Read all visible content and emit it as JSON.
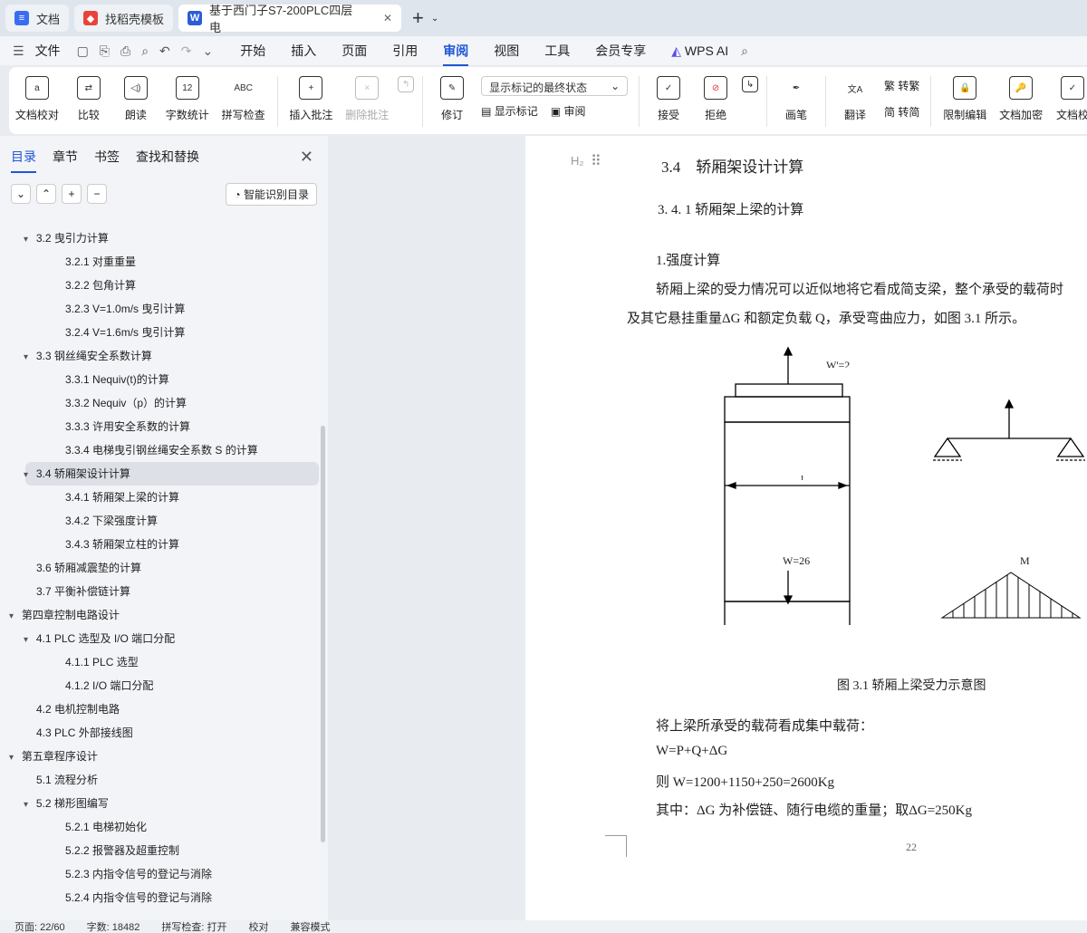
{
  "tabs": [
    {
      "label": "文档",
      "icon": "docs-icon",
      "color": "#3a6df0"
    },
    {
      "label": "找稻壳模板",
      "icon": "docer-icon",
      "color": "#e8443a"
    },
    {
      "label": "基于西门子S7-200PLC四层电",
      "icon": "word-icon",
      "color": "#2b5cd8"
    }
  ],
  "menu": {
    "file": "文件",
    "items": [
      "开始",
      "插入",
      "页面",
      "引用",
      "审阅",
      "视图",
      "工具",
      "会员专享"
    ],
    "active": "审阅",
    "wps_ai": "WPS AI"
  },
  "ribbon": {
    "b1": [
      "文档校对",
      "比较",
      "朗读",
      "字数统计",
      "拼写检查"
    ],
    "b2": [
      "插入批注",
      "删除批注"
    ],
    "markup_state": "显示标记的最终状态",
    "b3": [
      "修订",
      "显示标记",
      "审阅"
    ],
    "b4": [
      "接受",
      "拒绝"
    ],
    "b5": [
      "画笔"
    ],
    "b6": [
      "翻译",
      "繁转简",
      "转繁",
      "转简"
    ],
    "b7": [
      "限制编辑",
      "文档加密",
      "文档校"
    ]
  },
  "sidebar": {
    "tabs": [
      "目录",
      "章节",
      "书签",
      "查找和替换"
    ],
    "smart_toc": "智能识别目录",
    "items": [
      {
        "t": "3.2 曳引力计算",
        "l": 1,
        "e": true
      },
      {
        "t": "3.2.1  对重重量",
        "l": 2
      },
      {
        "t": "3.2.2   包角计算",
        "l": 2
      },
      {
        "t": "3.2.3  V=1.0m/s 曳引计算",
        "l": 2
      },
      {
        "t": "3.2.4   V=1.6m/s 曳引计算",
        "l": 2
      },
      {
        "t": "3.3   钢丝绳安全系数计算",
        "l": 1,
        "e": true
      },
      {
        "t": "3.3.1 Nequiv(t)的计算",
        "l": 2
      },
      {
        "t": "3.3.2 Nequiv（p）的计算",
        "l": 2
      },
      {
        "t": "3.3.3 许用安全系数的计算",
        "l": 2
      },
      {
        "t": "3.3.4 电梯曳引钢丝绳安全系数 S 的计算",
        "l": 2
      },
      {
        "t": "3.4   轿厢架设计计算",
        "l": 1,
        "e": true,
        "sel": true
      },
      {
        "t": "3.4.1 轿厢架上梁的计算",
        "l": 2
      },
      {
        "t": "3.4.2 下梁强度计算",
        "l": 2
      },
      {
        "t": "3.4.3 轿厢架立柱的计算",
        "l": 2
      },
      {
        "t": "3.6 轿厢减震垫的计算",
        "l": 1
      },
      {
        "t": "3.7 平衡补偿链计算",
        "l": 1
      },
      {
        "t": "第四章控制电路设计",
        "l": 0,
        "e": true
      },
      {
        "t": "4.1 PLC 选型及 I/O 端口分配",
        "l": 1,
        "e": true
      },
      {
        "t": "4.1.1 PLC 选型",
        "l": 2
      },
      {
        "t": "4.1.2 I/O 端口分配",
        "l": 2
      },
      {
        "t": "4.2  电机控制电路",
        "l": 1
      },
      {
        "t": "4.3 PLC 外部接线图",
        "l": 1
      },
      {
        "t": "第五章程序设计",
        "l": 0,
        "e": true
      },
      {
        "t": "5.1  流程分析",
        "l": 1
      },
      {
        "t": "5.2  梯形图编写",
        "l": 1,
        "e": true
      },
      {
        "t": "5.2.1  电梯初始化",
        "l": 2
      },
      {
        "t": "5.2.2 报警器及超重控制",
        "l": 2
      },
      {
        "t": "5.2.3  内指令信号的登记与消除",
        "l": 2
      },
      {
        "t": "5.2.4 内指令信号的登记与消除",
        "l": 2
      }
    ]
  },
  "doc": {
    "heading_mark": "H₂",
    "h3_num": "3.4",
    "h3_text": "轿厢架设计计算",
    "h4": "3. 4. 1 轿厢架上梁的计算",
    "p1": "1.强度计算",
    "p2": "轿厢上梁的受力情况可以近似地将它看成简支梁，整个承受的载荷时",
    "p3": "及其它悬挂重量ΔG 和额定负载 Q，承受弯曲应力，如图 3.1 所示。",
    "fig_w_top": "W'=2",
    "fig_l": "l",
    "fig_w_bot": "W=26",
    "fig_m": "M",
    "fig_caption": "图 3.1 轿厢上梁受力示意图",
    "p4": "将上梁所承受的载荷看成集中载荷：",
    "p5": "W=P+Q+ΔG",
    "p6": "则 W=1200+1150+250=2600Kg",
    "p7": "其中：ΔG 为补偿链、随行电缆的重量；取ΔG=250Kg",
    "page_num": "22"
  },
  "status": [
    "页面: 22/60",
    "字数: 18482",
    "拼写检查: 打开",
    "校对",
    "兼容模式"
  ]
}
